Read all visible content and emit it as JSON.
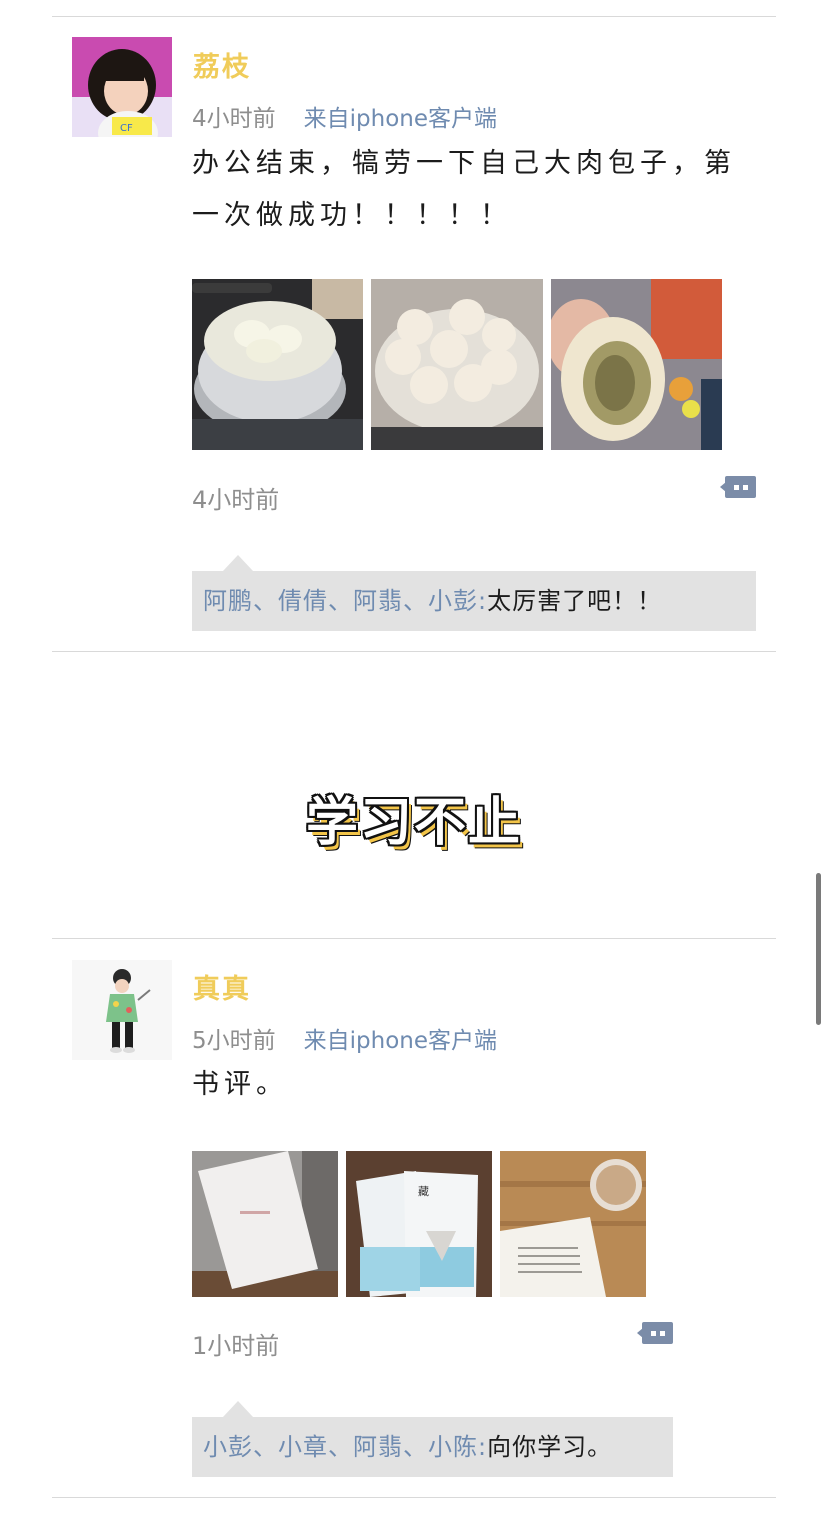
{
  "section_title": "学习不止",
  "posts": [
    {
      "username": "荔枝",
      "time": "4小时前",
      "source": "来自iphone客户端",
      "content": "办公结束，犒劳一下自己大肉包子，第一次做成功！！！！！",
      "images": [
        "steamer-pot-photo",
        "steamed-buns-photo",
        "bun-filling-photo"
      ],
      "bottom_time": "4小时前",
      "reply": {
        "likers": "阿鹏、倩倩、阿翡、小彭:",
        "text": "太厉害了吧！！"
      }
    },
    {
      "username": "真真",
      "time": "5小时前",
      "source": "来自iphone客户端",
      "content": "书评。",
      "images": [
        "book-cover-photo",
        "poetry-books-photo",
        "open-book-coffee-photo"
      ],
      "bottom_time": "1小时前",
      "reply": {
        "likers": "小彭、小章、阿翡、小陈:",
        "text": "向你学习。"
      }
    }
  ],
  "icons": {
    "comment": "comment-bubble-icon"
  },
  "colors": {
    "username": "#f0cc5a",
    "link": "#6f8bb0",
    "reply_bg": "#e2e2e2",
    "title_shadow": "#f3c549"
  }
}
